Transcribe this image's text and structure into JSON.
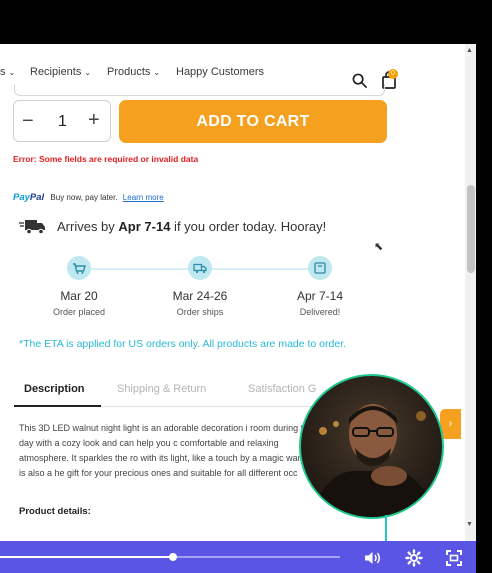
{
  "nav": {
    "items": [
      {
        "label": "s",
        "chevron": true
      },
      {
        "label": "Recipients",
        "chevron": true
      },
      {
        "label": "Products",
        "chevron": true
      },
      {
        "label": "Happy Customers",
        "chevron": false
      }
    ],
    "cart_count": "0"
  },
  "purchase": {
    "qty_minus": "−",
    "qty_value": "1",
    "qty_plus": "+",
    "add_to_cart": "ADD TO CART",
    "error": "Error: Some fields are required or invalid data"
  },
  "paypal": {
    "brand_pay": "Pay",
    "brand_pal": "Pal",
    "text": "Buy now, pay later.",
    "learn_more": "Learn more"
  },
  "shipping": {
    "arrives_prefix": "Arrives by ",
    "arrives_dates": "Apr 7-14",
    "arrives_suffix": " if you order today. Hooray!",
    "steps": [
      {
        "date": "Mar 20",
        "label": "Order placed",
        "icon": "cart-icon"
      },
      {
        "date": "Mar 24-26",
        "label": "Order ships",
        "icon": "truck-icon"
      },
      {
        "date": "Apr 7-14",
        "label": "Delivered!",
        "icon": "box-icon"
      }
    ],
    "eta_note": "*The ETA is applied for US orders only. All products are made to order."
  },
  "tabs": [
    {
      "label": "Description",
      "active": true
    },
    {
      "label": "Shipping & Return",
      "active": false
    },
    {
      "label": "Satisfaction G",
      "active": false
    }
  ],
  "description": {
    "text": "This 3D LED walnut night light is an adorable decoration i room during the day with a cozy look and can help you c comfortable and relaxing atmosphere. It sparkles the ro with its light, like a touch by a magic wand. It is also a he gift for your precious ones and suitable for all different occ",
    "details_heading": "Product details:"
  },
  "colors": {
    "accent_orange": "#f6a01f",
    "eta_teal": "#2bb8d3",
    "error_red": "#e02020",
    "player_bar": "#5b55e5"
  },
  "player": {
    "progress": 0.51,
    "icons": [
      "volume-icon",
      "settings-icon",
      "fullscreen-icon"
    ]
  }
}
